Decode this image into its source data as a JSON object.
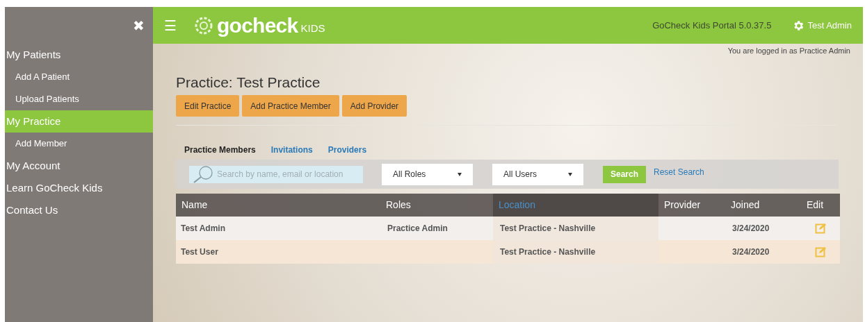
{
  "sidebar": {
    "close_icon": "✖",
    "items": [
      {
        "label": "My Patients",
        "selected": false,
        "children": [
          {
            "label": "Add A Patient",
            "selected": false
          },
          {
            "label": "Upload Patients",
            "selected": false
          }
        ]
      },
      {
        "label": "My Practice",
        "selected": true,
        "children": [
          {
            "label": "Add Member",
            "selected": false
          }
        ]
      },
      {
        "label": "My Account",
        "selected": false
      },
      {
        "label": "Learn GoCheck Kids",
        "selected": false
      },
      {
        "label": "Contact Us",
        "selected": false
      }
    ]
  },
  "header": {
    "menu_icon": "☰",
    "logo": {
      "main": "gocheck",
      "suffix": "KIDS"
    },
    "version": "GoCheck Kids Portal 5.0.37.5",
    "user": "Test Admin"
  },
  "login_note": "You are logged in as Practice Admin",
  "page_title": "Practice: Test Practice",
  "actions": [
    "Edit Practice",
    "Add Practice Member",
    "Add Provider"
  ],
  "tabs": [
    {
      "label": "Practice Members",
      "selected": true
    },
    {
      "label": "Invitations",
      "selected": false
    },
    {
      "label": "Providers",
      "selected": false
    }
  ],
  "filters": {
    "search": {
      "placeholder": "Search by name, email or location"
    },
    "roles": "All Roles",
    "users": "All Users",
    "search_button": "Search",
    "reset": "Reset Search"
  },
  "table": {
    "columns": [
      {
        "label": "Name",
        "sorted": false
      },
      {
        "label": "Roles",
        "sorted": false
      },
      {
        "label": "Location",
        "sorted": true
      },
      {
        "label": "Provider",
        "sorted": false
      },
      {
        "label": "Joined",
        "sorted": false
      },
      {
        "label": "Edit",
        "sorted": false
      }
    ],
    "rows": [
      {
        "name": "Test Admin",
        "roles": "Practice Admin",
        "location": "Test Practice - Nashville",
        "joined": "3/24/2020"
      },
      {
        "name": "Test User",
        "location": "Test Practice - Nashville",
        "joined": "3/24/2020"
      }
    ]
  }
}
